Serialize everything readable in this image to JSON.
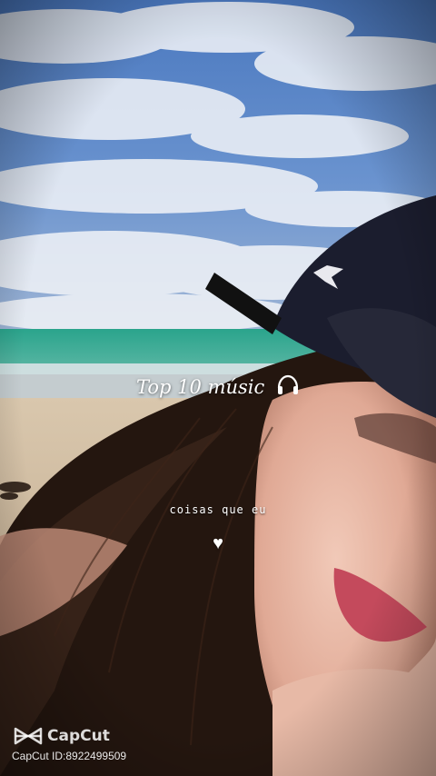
{
  "overlay": {
    "title": "Top 10 músic",
    "title_icon": "headphones-icon",
    "subtitle": "coisas que eu",
    "heart": "♥",
    "heart_icon": "heart-icon"
  },
  "watermark": {
    "brand": "CapCut",
    "logo_icon": "capcut-logo-icon",
    "id_text": "CapCut ID:8922499509"
  },
  "colors": {
    "sky": "#3e78c8",
    "sea": "#2fa08a",
    "sand": "#cbb79a",
    "cap": "#1a1c2e",
    "hair": "#2a1a14",
    "skin": "#e8b7a4",
    "lips": "#c84a5e"
  }
}
